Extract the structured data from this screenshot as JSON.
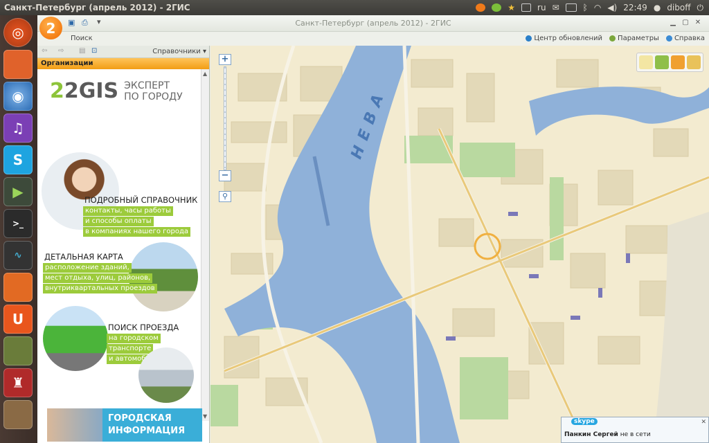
{
  "topbar": {
    "title": "Санкт-Петербург (апрель 2012) - 2ГИС",
    "kbd_layout": "ru",
    "time": "22:49",
    "user": "diboff"
  },
  "launcher": {
    "items": [
      "ubuntu-icon",
      "files-icon",
      "chromium-icon",
      "viber-icon",
      "skype-icon",
      "media-player-icon",
      "terminal-icon",
      "system-monitor-icon",
      "app-icon",
      "ubuntu-one-icon",
      "tank-icon",
      "wine-icon",
      "storage-icon"
    ]
  },
  "window": {
    "title": "Санкт-Петербург (апрель 2012) - 2ГИС",
    "search_label": "Поиск",
    "links": {
      "updates": "Центр обновлений",
      "params": "Параметры",
      "help": "Справка"
    }
  },
  "panel": {
    "directories_label": "Справочники",
    "org_label": "Организации",
    "promo": {
      "logo": "2GIS",
      "tagline1": "ЭКСПЕРТ",
      "tagline2": "ПО ГОРОДУ",
      "block1": {
        "heading": "ПОДРОБНЫЙ СПРАВОЧНИК",
        "lines": [
          "контакты, часы работы",
          "и способы оплаты",
          "в компаниях нашего города"
        ]
      },
      "block2": {
        "heading": "ДЕТАЛЬНАЯ КАРТА",
        "lines": [
          "расположение зданий,",
          "мест отдыха, улиц, районов,",
          "внутриквартальных проездов"
        ]
      },
      "block3": {
        "heading": "ПОИСК ПРОЕЗДА",
        "lines": [
          "на городском",
          "транспорте",
          "и автомобиле"
        ]
      },
      "banner": [
        "ГОРОДСКАЯ",
        "ИНФОРМАЦИЯ"
      ]
    }
  },
  "map": {
    "river_label": "НЕВА"
  },
  "skype": {
    "logo": "skype",
    "name": "Панкин Сергей",
    "status": "не в сети"
  },
  "colors": {
    "accent_orange": "#f29d14",
    "gis_green": "#8dc43a",
    "river": "#8fb1d9",
    "land": "#f3ebd0",
    "park": "#b9d9a0"
  }
}
